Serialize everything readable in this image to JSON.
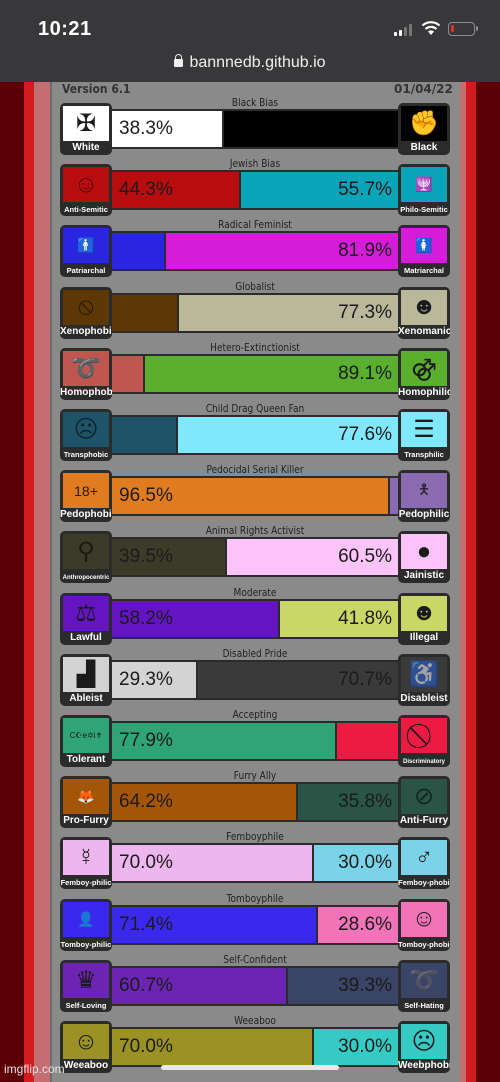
{
  "status_bar": {
    "time": "10:21"
  },
  "browser": {
    "url": "bannnedb.github.io"
  },
  "header": {
    "version": "Version 6.1",
    "date": "01/04/22"
  },
  "watermark": "imgflip.com",
  "chart_data": {
    "type": "bar",
    "orientation": "horizontal-stacked-100",
    "title": "",
    "rows": [
      {
        "category": "Black Bias",
        "left_label": "White",
        "right_label": "Black",
        "left_value": 38.3,
        "right_value": 61.7,
        "left_text": "38.3%",
        "right_text": "",
        "left_color": "#ffffff",
        "right_color": "#000000",
        "left_icon": "iron-cross-flag-icon",
        "right_icon": "raised-fist-icon"
      },
      {
        "category": "Jewish Bias",
        "left_label": "Anti-Semitic",
        "right_label": "Philo-Semitic",
        "left_value": 44.3,
        "right_value": 55.7,
        "left_text": "44.3%",
        "right_text": "55.7%",
        "left_color": "#b80d0f",
        "right_color": "#0aa4b8",
        "left_icon": "caricature-face-icon",
        "right_icon": "menorah-emblem-icon"
      },
      {
        "category": "Radical Feminist",
        "left_label": "Patriarchal",
        "right_label": "Matriarchal",
        "left_value": 18.1,
        "right_value": 81.9,
        "left_text": "",
        "right_text": "81.9%",
        "left_color": "#2a25e0",
        "right_color": "#d51dd9",
        "left_icon": "male-figure-icon",
        "right_icon": "female-figure-icon"
      },
      {
        "category": "Globalist",
        "left_label": "Xenophobic",
        "right_label": "Xenomanic",
        "left_value": 22.7,
        "right_value": 77.3,
        "left_text": "",
        "right_text": "77.3%",
        "left_color": "#5e3804",
        "right_color": "#b9b89a",
        "left_icon": "no-alien-icon",
        "right_icon": "crowd-globe-icon"
      },
      {
        "category": "Hetero-Extinctionist",
        "left_label": "Homophobic",
        "right_label": "Homophilic",
        "left_value": 10.9,
        "right_value": 89.1,
        "left_text": "",
        "right_text": "89.1%",
        "left_color": "#c05650",
        "right_color": "#5ab02e",
        "left_icon": "noose-icon",
        "right_icon": "double-male-symbol-icon"
      },
      {
        "category": "Child Drag Queen Fan",
        "left_label": "Transphobic",
        "right_label": "Transphilic",
        "left_value": 22.4,
        "right_value": 77.6,
        "left_text": "",
        "right_text": "77.6%",
        "left_color": "#1f5468",
        "right_color": "#7fe8fc",
        "left_icon": "screaming-face-icon",
        "right_icon": "striped-flag-icon"
      },
      {
        "category": "Pedocidal Serial Killer",
        "left_label": "Pedophobic",
        "right_label": "Pedophilic",
        "left_value": 96.5,
        "right_value": 3.5,
        "left_text": "96.5%",
        "right_text": "",
        "left_color": "#e07b20",
        "right_color": "#8a6ab0",
        "left_icon": "18-plus-icon",
        "right_icon": "child-figure-icon"
      },
      {
        "category": "Animal Rights Activist",
        "left_label": "Anthropocentric",
        "right_label": "Jainistic",
        "left_value": 39.5,
        "right_value": 60.5,
        "left_text": "39.5%",
        "right_text": "60.5%",
        "left_color": "#3c3b2a",
        "right_color": "#fdc3fb",
        "left_icon": "hanging-animal-icon",
        "right_icon": "pig-circle-icon"
      },
      {
        "category": "Moderate",
        "left_label": "Lawful",
        "right_label": "Illegal",
        "left_value": 58.2,
        "right_value": 41.8,
        "left_text": "58.2%",
        "right_text": "41.8%",
        "left_color": "#6415c1",
        "right_color": "#c8d765",
        "left_icon": "scales-icon",
        "right_icon": "robber-icon"
      },
      {
        "category": "Disabled Pride",
        "left_label": "Ableist",
        "right_label": "Disableist",
        "left_value": 29.3,
        "right_value": 70.7,
        "left_text": "29.3%",
        "right_text": "70.7%",
        "left_color": "#d3d3d3",
        "right_color": "#3a3a3a",
        "left_icon": "stairs-icon",
        "right_icon": "wheelchair-icon"
      },
      {
        "category": "Accepting",
        "left_label": "Tolerant",
        "right_label": "Discriminatory",
        "left_value": 77.9,
        "right_value": 22.1,
        "left_text": "77.9%",
        "right_text": "",
        "left_color": "#2fa474",
        "right_color": "#ec1b43",
        "left_icon": "coexist-icon",
        "right_icon": "prohibition-icon"
      },
      {
        "category": "Furry Ally",
        "left_label": "Pro-Furry",
        "right_label": "Anti-Furry",
        "left_value": 64.2,
        "right_value": 35.8,
        "left_text": "64.2%",
        "right_text": "35.8%",
        "left_color": "#a35608",
        "right_color": "#2a5446",
        "left_icon": "fox-icon",
        "right_icon": "no-paw-flag-icon"
      },
      {
        "category": "Femboyphile",
        "left_label": "Femboy-philic",
        "right_label": "Femboy-phobic",
        "left_value": 70.0,
        "right_value": 30.0,
        "left_text": "70.0%",
        "right_text": "30.0%",
        "left_color": "#edb6ee",
        "right_color": "#7ad3e8",
        "left_icon": "femboy-symbol-icon",
        "right_icon": "male-symbol-icon"
      },
      {
        "category": "Tomboyphile",
        "left_label": "Tomboy-philic",
        "right_label": "Tomboy-phobic",
        "left_value": 71.4,
        "right_value": 28.6,
        "left_text": "71.4%",
        "right_text": "28.6%",
        "left_color": "#3b28ee",
        "right_color": "#f273b8",
        "left_icon": "tomboy-bust-icon",
        "right_icon": "long-hair-face-icon"
      },
      {
        "category": "Self-Confident",
        "left_label": "Self-Loving",
        "right_label": "Self-Hating",
        "left_value": 60.7,
        "right_value": 39.3,
        "left_text": "60.7%",
        "right_text": "39.3%",
        "left_color": "#6b25b2",
        "right_color": "#3a4466",
        "left_icon": "crown-icon",
        "right_icon": "noose-icon"
      },
      {
        "category": "Weeaboo",
        "left_label": "Weeaboo",
        "right_label": "Weebphobic",
        "left_value": 70.0,
        "right_value": 30.0,
        "left_text": "70.0%",
        "right_text": "30.0%",
        "left_color": "#9b9125",
        "right_color": "#35cbc4",
        "left_icon": "anime-girl-icon",
        "right_icon": "angry-face-icon"
      }
    ],
    "xlim": [
      0,
      100
    ],
    "unit": "%"
  }
}
